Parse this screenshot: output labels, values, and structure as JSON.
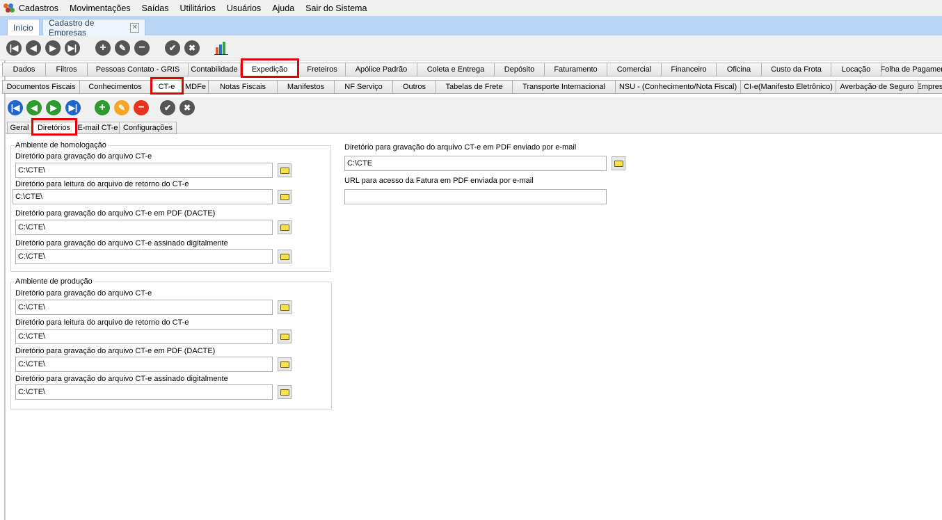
{
  "menu": [
    "Cadastros",
    "Movimentações",
    "Saídas",
    "Utilitários",
    "Usuários",
    "Ajuda",
    "Sair do Sistema"
  ],
  "doc_tabs": [
    "Início",
    "Cadastro de Empresas"
  ],
  "main_tabs": [
    "Dados",
    "Filtros",
    "Pessoas Contato - GRIS",
    "Contabilidade",
    "Expedição",
    "Freteiros",
    "Apólice Padrão",
    "Coleta e Entrega",
    "Depósito",
    "Faturamento",
    "Comercial",
    "Financeiro",
    "Oficina",
    "Custo da Frota",
    "Locação",
    "Folha de Pagamento"
  ],
  "sub_tabs": [
    "Documentos Fiscais",
    "Conhecimentos",
    "CT-e",
    "MDFe",
    "Notas Fiscais",
    "Manifestos",
    "NF Serviço",
    "Outros",
    "Tabelas de Frete",
    "Transporte Internacional",
    "NSU - (Conhecimento/Nota Fiscal)",
    "CI-e(Manifesto Eletrônico)",
    "Averbação de Seguro",
    "Empresa"
  ],
  "cte_tabs": [
    "Geral",
    "Diretórios",
    "E-mail CT-e",
    "Configurações"
  ],
  "homolog": {
    "title": "Ambiente de homologação",
    "fields": [
      {
        "label": "Diretório para gravação do arquivo CT-e",
        "value": "C:\\CTE\\"
      },
      {
        "label": "Diretório para leitura do arquivo de retorno do CT-e",
        "value": "C:\\CTE\\"
      },
      {
        "label": "Diretório para gravação do arquivo CT-e em PDF (DACTE)",
        "value": "C:\\CTE\\"
      },
      {
        "label": "Diretório para gravação do arquivo CT-e assinado digitalmente",
        "value": "C:\\CTE\\"
      }
    ]
  },
  "producao": {
    "title": "Ambiente de produção",
    "fields": [
      {
        "label": "Diretório para gravação do arquivo CT-e",
        "value": "C:\\CTE\\"
      },
      {
        "label": "Diretório para leitura do arquivo de retorno do CT-e",
        "value": "C:\\CTE\\"
      },
      {
        "label": "Diretório para gravação do arquivo CT-e em PDF (DACTE)",
        "value": "C:\\CTE\\"
      },
      {
        "label": "Diretório para gravação do arquivo CT-e assinado digitalmente",
        "value": "C:\\CTE\\"
      }
    ]
  },
  "right": {
    "pdf_label": "Diretório para gravação do arquivo CT-e em PDF enviado por e-mail",
    "pdf_value": "C:\\CTE",
    "url_label": "URL para acesso da Fatura em PDF enviada por e-mail",
    "url_value": ""
  }
}
